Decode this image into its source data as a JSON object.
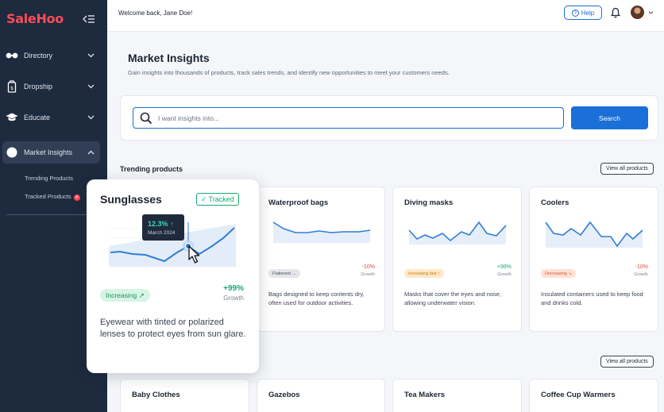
{
  "brand": "SaleHoo",
  "sidebar": {
    "items": [
      {
        "label": "Directory",
        "icon": "glasses-icon"
      },
      {
        "label": "Dropship",
        "icon": "box-icon"
      },
      {
        "label": "Educate",
        "icon": "graduation-cap-icon"
      },
      {
        "label": "Market Insights",
        "icon": "circle-icon",
        "active": true
      }
    ],
    "sub_items": [
      {
        "label": "Trending Products"
      },
      {
        "label": "Tracked Products",
        "badge": "4"
      }
    ]
  },
  "topbar": {
    "welcome": "Welcome back, Jane Doe!",
    "help_label": "Help",
    "help_glyph": "?"
  },
  "page": {
    "title": "Market Insights",
    "subtitle": "Gain insights into thousands of products, track sales trends, and identify new opportunities to meet your customers needs."
  },
  "search": {
    "placeholder": "I want insights into...",
    "value": "",
    "button_label": "Search"
  },
  "trending": {
    "title": "Trending products",
    "view_all": "View all products",
    "cards": [
      {
        "title": "Waterproof bags",
        "trend_label": "Flattened →",
        "trend_type": "flat",
        "pct": "-10%",
        "growth_label": "Growth",
        "description": "Bags designed to keep contents dry, often used for outdoor activities."
      },
      {
        "title": "Diving masks",
        "trend_label": "Increasing fast ↑",
        "trend_type": "increasing",
        "pct": "+99%",
        "growth_label": "Growth",
        "description": "Masks that cover the eyes and nose, allowing underwater vision."
      },
      {
        "title": "Coolers",
        "trend_label": "Decreasing ↘",
        "trend_type": "decreasing",
        "pct": "-10%",
        "growth_label": "Growth",
        "description": "Insulated containers used to keep food and drinks cold."
      }
    ]
  },
  "featured": {
    "title": "Sunglasses",
    "tracked_label": "Tracked",
    "tracked_check": "✓",
    "tooltip_value": "12.3% ↑",
    "tooltip_date": "March 2024",
    "trend_label": "Increasing ↗",
    "pct": "+99%",
    "growth_label": "Growth",
    "description": "Eyewear with tinted or polarized lenses to protect eyes from sun glare."
  },
  "second_section": {
    "view_all": "View all products",
    "cards": [
      {
        "title": "Baby Clothes"
      },
      {
        "title": "Gazebos"
      },
      {
        "title": "Tea Makers"
      },
      {
        "title": "Coffee Cup Warmers"
      }
    ]
  },
  "colors": {
    "sidebar_bg": "#1e2a3e",
    "brand": "#ff4b57",
    "accent": "#1a6fd8",
    "positive": "#19a870",
    "negative": "#e0483d"
  }
}
